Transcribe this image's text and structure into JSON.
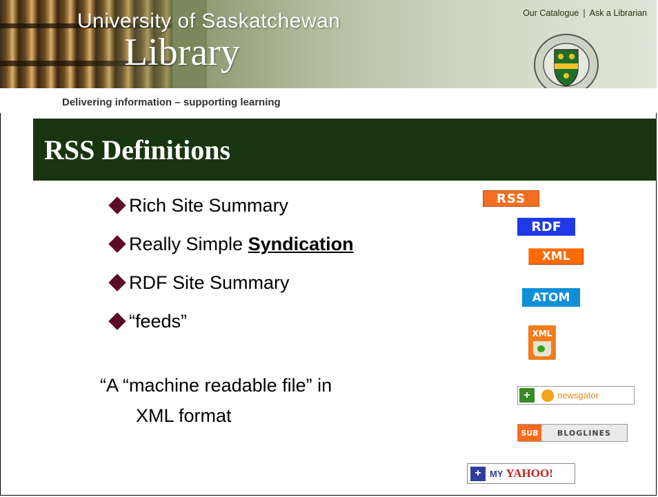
{
  "header": {
    "university": "University of Saskatchewan",
    "library": "Library",
    "tagline": "Delivering information – supporting learning",
    "links": [
      "Our Catalogue",
      "Ask a Librarian"
    ],
    "separator": "|",
    "crest_text": "UNIVERSITY OF SASKATCHEWAN"
  },
  "slide": {
    "title": "RSS Definitions",
    "bullets": [
      {
        "text": "Rich Site Summary"
      },
      {
        "prefix": "Really Simple ",
        "link": "Syndication"
      },
      {
        "text": "RDF Site Summary"
      },
      {
        "text": "“feeds”"
      }
    ],
    "quote_line1": "“A “machine readable file” in",
    "quote_line2": "XML format"
  },
  "badges": {
    "rss": "RSS",
    "rdf": "RDF",
    "xml": "XML",
    "atom": "ATOM",
    "xml_mug": "XML",
    "newsgator_plus": "+",
    "newsgator": "newsgator",
    "bloglines_sub": "SUB",
    "bloglines": "BLOGLINES",
    "yahoo_plus": "+",
    "yahoo_my": "MY",
    "yahoo": "YAHOO!"
  },
  "colors": {
    "title_bar": "#193510",
    "bullet": "#5b0b28",
    "rss": "#f36f23",
    "rdf": "#1f39e6",
    "atom": "#0f8fd8"
  },
  "icons": [
    "diamond-bullet-icon",
    "university-crest-icon",
    "xml-mug-icon"
  ]
}
